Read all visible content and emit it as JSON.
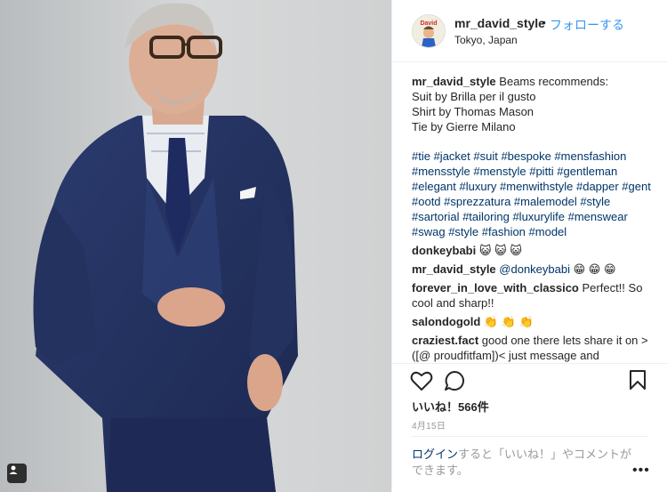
{
  "post": {
    "username": "mr_david_style",
    "separator": "•",
    "follow_label": "フォローする",
    "location": "Tokyo, Japan",
    "caption_lines": [
      "Beams recommends:",
      "Suit by Brilla per il gusto",
      "Shirt by Thomas Mason",
      "Tie by Gierre Milano"
    ],
    "hashtags": "#tie #jacket #suit #bespoke #mensfashion #mensstyle #menstyle #pitti #gentleman #elegant #luxury #menwithstyle #dapper #gent #ootd #sprezzatura #malemodel #style #sartorial #tailoring #luxurylife #menswear #swag #style #fashion #model",
    "likes": "いいね！566件",
    "date": "4月15日"
  },
  "comments": [
    {
      "user": "donkeybabi",
      "text": "😺 😺 😺"
    },
    {
      "user": "mr_david_style",
      "mention": "@donkeybabi",
      "text": "😁 😁 😁"
    },
    {
      "user": "forever_in_love_with_classico",
      "text": "Perfect!! So cool and sharp!!"
    },
    {
      "user": "salondogold",
      "text": "👏 👏 👏"
    },
    {
      "user": "craziest.fact",
      "text": "good one there lets share it on >([@ proudfitfam])< just message and"
    }
  ],
  "login": {
    "link": "ログイン",
    "rest": "すると「いいね！」やコメントができます。"
  },
  "icons": [
    "user-tag-icon",
    "heart-icon",
    "comment-icon",
    "bookmark-icon",
    "more-options-icon"
  ],
  "colors": {
    "link": "#003569",
    "follow": "#3897f0",
    "text": "#262626",
    "muted": "#999999"
  }
}
